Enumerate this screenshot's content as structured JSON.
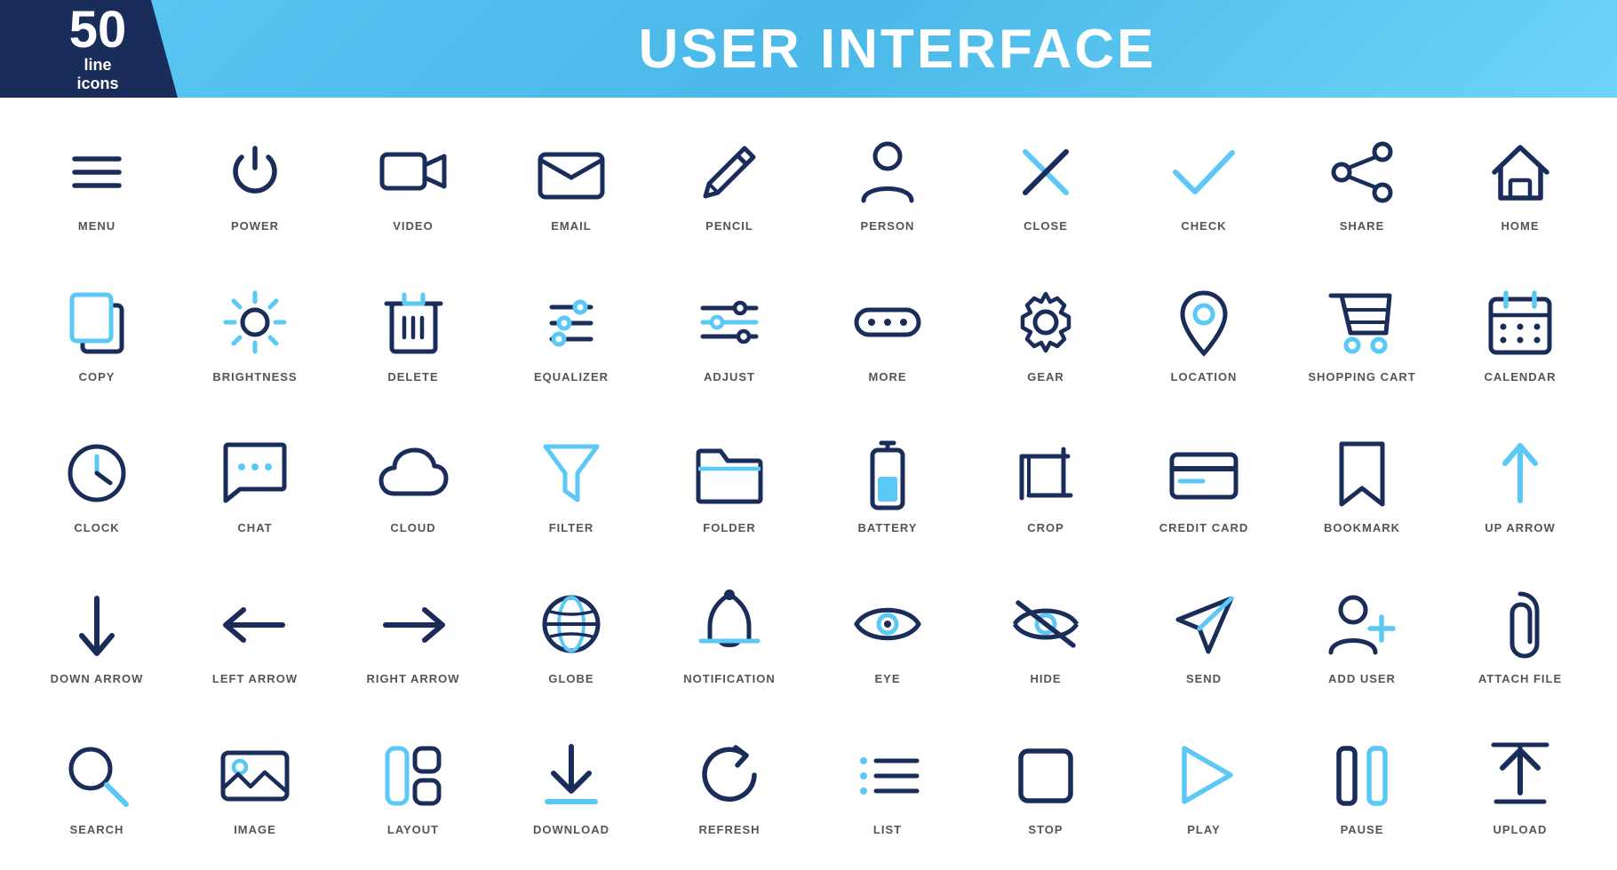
{
  "header": {
    "number": "50",
    "line": "line",
    "icons": "icons",
    "title": "USER INTERFACE"
  },
  "icons": [
    {
      "name": "menu-icon",
      "label": "MENU"
    },
    {
      "name": "power-icon",
      "label": "POWER"
    },
    {
      "name": "video-icon",
      "label": "VIDEO"
    },
    {
      "name": "email-icon",
      "label": "EMAIL"
    },
    {
      "name": "pencil-icon",
      "label": "PENCIL"
    },
    {
      "name": "person-icon",
      "label": "PERSON"
    },
    {
      "name": "close-icon",
      "label": "CLOSE"
    },
    {
      "name": "check-icon",
      "label": "CHECK"
    },
    {
      "name": "share-icon",
      "label": "SHARE"
    },
    {
      "name": "home-icon",
      "label": "HOME"
    },
    {
      "name": "copy-icon",
      "label": "COPY"
    },
    {
      "name": "brightness-icon",
      "label": "BRIGHTNESS"
    },
    {
      "name": "delete-icon",
      "label": "DELETE"
    },
    {
      "name": "equalizer-icon",
      "label": "EQUALIZER"
    },
    {
      "name": "adjust-icon",
      "label": "ADJUST"
    },
    {
      "name": "more-icon",
      "label": "MORE"
    },
    {
      "name": "gear-icon",
      "label": "GEAR"
    },
    {
      "name": "location-icon",
      "label": "LOCATION"
    },
    {
      "name": "shopping-cart-icon",
      "label": "SHOPPING CART"
    },
    {
      "name": "calendar-icon",
      "label": "CALENDAR"
    },
    {
      "name": "clock-icon",
      "label": "CLOCK"
    },
    {
      "name": "chat-icon",
      "label": "CHAT"
    },
    {
      "name": "cloud-icon",
      "label": "CLOUD"
    },
    {
      "name": "filter-icon",
      "label": "FILTER"
    },
    {
      "name": "folder-icon",
      "label": "FOLDER"
    },
    {
      "name": "battery-icon",
      "label": "BATTERY"
    },
    {
      "name": "crop-icon",
      "label": "CROP"
    },
    {
      "name": "credit-card-icon",
      "label": "CREDIT CARD"
    },
    {
      "name": "bookmark-icon",
      "label": "BOOKMARK"
    },
    {
      "name": "up-arrow-icon",
      "label": "UP ARROW"
    },
    {
      "name": "down-arrow-icon",
      "label": "DOWN ARROW"
    },
    {
      "name": "left-arrow-icon",
      "label": "LEFT ARROW"
    },
    {
      "name": "right-arrow-icon",
      "label": "RIGHT ARROW"
    },
    {
      "name": "globe-icon",
      "label": "GLOBE"
    },
    {
      "name": "notification-icon",
      "label": "NOTIFICATION"
    },
    {
      "name": "eye-icon",
      "label": "EYE"
    },
    {
      "name": "hide-icon",
      "label": "HIDE"
    },
    {
      "name": "send-icon",
      "label": "SEND"
    },
    {
      "name": "add-user-icon",
      "label": "ADD USER"
    },
    {
      "name": "attach-file-icon",
      "label": "ATTACH FILE"
    },
    {
      "name": "search-icon",
      "label": "SEARCH"
    },
    {
      "name": "image-icon",
      "label": "IMAGE"
    },
    {
      "name": "layout-icon",
      "label": "LAYOUT"
    },
    {
      "name": "download-icon",
      "label": "DOWNLOAD"
    },
    {
      "name": "refresh-icon",
      "label": "REFRESH"
    },
    {
      "name": "list-icon",
      "label": "LIST"
    },
    {
      "name": "stop-icon",
      "label": "STOP"
    },
    {
      "name": "play-icon",
      "label": "PLAY"
    },
    {
      "name": "pause-icon",
      "label": "PAUSE"
    },
    {
      "name": "upload-icon",
      "label": "UPLOAD"
    }
  ],
  "colors": {
    "dark": "#1a2d5a",
    "blue": "#5bc8f5",
    "accent": "#4ab0e0"
  }
}
